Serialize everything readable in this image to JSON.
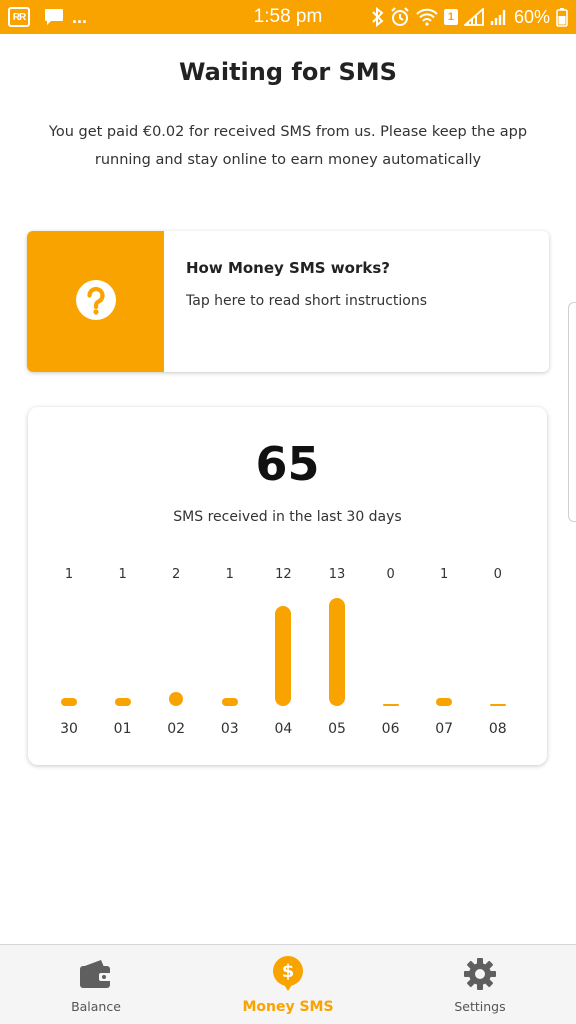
{
  "status_bar": {
    "rr_label": "RR",
    "dots": "...",
    "time": "1:58 pm",
    "sim_badge": "1",
    "battery": "60%"
  },
  "header": {
    "title": "Waiting for SMS",
    "subtitle": "You get paid €0.02 for received SMS from us. Please keep the app running and stay online to earn money automatically"
  },
  "info_card": {
    "title": "How Money SMS works?",
    "description": "Tap here to read short instructions",
    "icon": "question-circle-icon"
  },
  "stats": {
    "total": "65",
    "label": "SMS received in the last 30 days"
  },
  "chart_data": {
    "type": "bar",
    "categories": [
      "30",
      "01",
      "02",
      "03",
      "04",
      "05",
      "06",
      "07",
      "08"
    ],
    "values": [
      1,
      1,
      2,
      1,
      12,
      13,
      0,
      1,
      0
    ],
    "title": "",
    "xlabel": "",
    "ylabel": "",
    "grid": false
  },
  "nav": {
    "items": [
      {
        "label": "Balance",
        "icon": "wallet-icon",
        "active": false
      },
      {
        "label": "Money SMS",
        "icon": "money-sms-icon",
        "active": true
      },
      {
        "label": "Settings",
        "icon": "gear-icon",
        "active": false
      }
    ]
  },
  "colors": {
    "accent": "#F9A300",
    "nav_icon": "#5f5f5f"
  }
}
